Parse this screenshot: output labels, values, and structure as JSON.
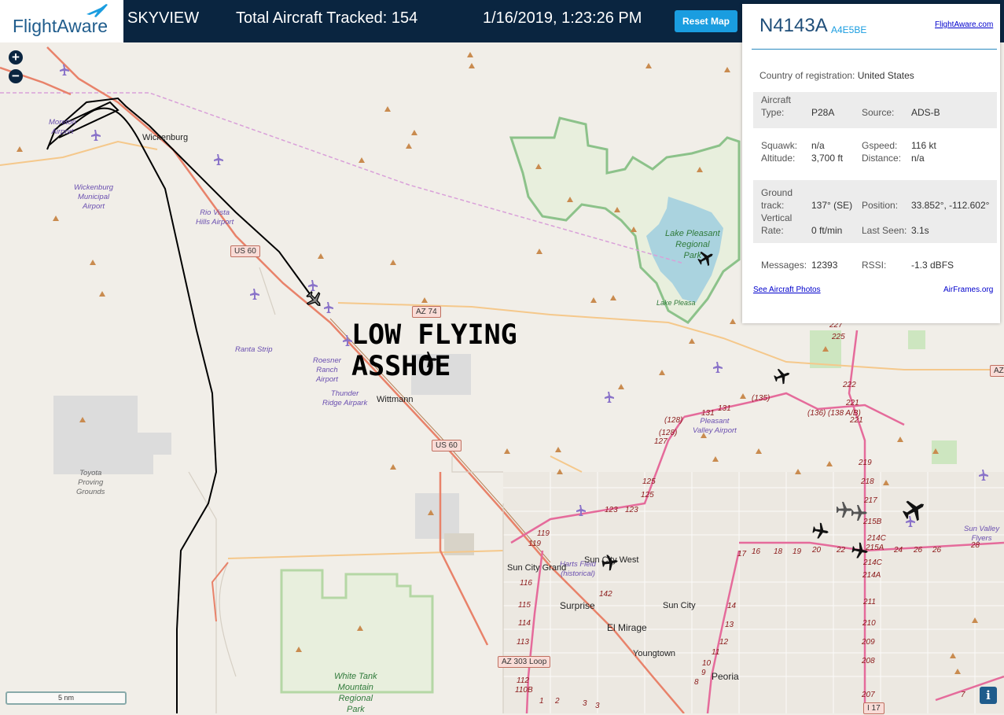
{
  "header": {
    "logo_text": "FlightAware",
    "app_name": "SKYVIEW",
    "tracked": "Total Aircraft Tracked: 154",
    "datetime": "1/16/2019, 1:23:26 PM",
    "reset_label": "Reset Map"
  },
  "map": {
    "zoom_in": "+",
    "zoom_out": "−",
    "scale_label": "5 nm",
    "info_label": "i",
    "overlay_line1": "LOW FLYING",
    "overlay_line2": "ASSHOE",
    "towns": {
      "wickenburg": "Wickenburg",
      "wittmann": "Wittmann",
      "sun_city_grand": "Sun City Grand",
      "sun_city_west": "Sun City West",
      "surprise": "Surprise",
      "sun_city": "Sun City",
      "el_mirage": "El Mirage",
      "youngtown": "Youngtown",
      "peoria": "Peoria"
    },
    "airports": {
      "moreton": "Moreton\nAirport",
      "wickenburg_muni": "Wickenburg\nMunicipal\nAirport",
      "rio_vista": "Rio Vista\nHills Airport",
      "ranta": "Ranta Strip",
      "roesner": "Roesner\nRanch\nAirport",
      "thunder_ridge": "Thunder\nRidge Airpark",
      "pleasant_valley": "Pleasant\nValley Airport",
      "harts_field": "Harts Field\n(historical)",
      "sun_valley": "Sun Valley\nFlyers"
    },
    "parks": {
      "lake_pleasant": "Lake Pleasant\nRegional\nPark",
      "lake": "Lake Pleasa",
      "white_tank": "White Tank\nMountain\nRegional\nPark",
      "toyota": "Toyota\nProving\nGrounds"
    },
    "shields": {
      "us60_a": "US 60",
      "us60_b": "US 60",
      "az74": "AZ 74",
      "az303": "AZ 303 Loop",
      "i17": "I 17",
      "az_edge": "AZ"
    },
    "route_numbers": [
      "(128)",
      "(128)",
      "127",
      "125",
      "125",
      "123",
      "123",
      "119",
      "119",
      "116",
      "115",
      "114",
      "113",
      "112",
      "110B",
      "1",
      "2",
      "3",
      "3",
      "142",
      "131",
      "131",
      "(135)",
      "(136)",
      "(138 A/B)",
      "227",
      "225",
      "222",
      "221",
      "221",
      "219",
      "218",
      "217",
      "215B",
      "214C",
      "215A",
      "214C",
      "214A",
      "211",
      "210",
      "209",
      "208",
      "207",
      "17",
      "16",
      "18",
      "19",
      "20",
      "22",
      "24",
      "26",
      "26",
      "28",
      "14",
      "13",
      "12",
      "11",
      "10",
      "9",
      "8",
      "7"
    ]
  },
  "panel": {
    "registration": "N4143A",
    "hex": "A4E5BE",
    "fa_link": "FlightAware.com",
    "country_label": "Country of registration:",
    "country_value": "United States",
    "rows": {
      "aircraft_type_label": "Aircraft\nType:",
      "aircraft_type_value": "P28A",
      "source_label": "Source:",
      "source_value": "ADS-B",
      "squawk_label": "Squawk:",
      "squawk_value": "n/a",
      "gspeed_label": "Gspeed:",
      "gspeed_value": "116 kt",
      "altitude_label": "Altitude:",
      "altitude_value": "3,700 ft",
      "distance_label": "Distance:",
      "distance_value": "n/a",
      "ground_track_label": "Ground\ntrack:",
      "ground_track_value": "137° (SE)",
      "position_label": "Position:",
      "position_value": "33.852°, -112.602°",
      "vertical_rate_label": "Vertical\nRate:",
      "vertical_rate_value": "0 ft/min",
      "last_seen_label": "Last Seen:",
      "last_seen_value": "3.1s",
      "messages_label": "Messages:",
      "messages_value": "12393",
      "rssi_label": "RSSI:",
      "rssi_value": "-1.3 dBFS"
    },
    "photos_link": "See Aircraft Photos",
    "airframes_link": "AirFrames.org"
  },
  "colors": {
    "header_bg": "#0a2540",
    "accent": "#1a9de0",
    "map_bg": "#f1eee8",
    "park_green": "#8cc28a",
    "water": "#aad3df",
    "road_primary": "#e8826a",
    "road_secondary": "#f5c88b",
    "route_pink": "#e56b9b",
    "track_line": "#000000",
    "airspace_dashed": "#d9a0d9"
  }
}
